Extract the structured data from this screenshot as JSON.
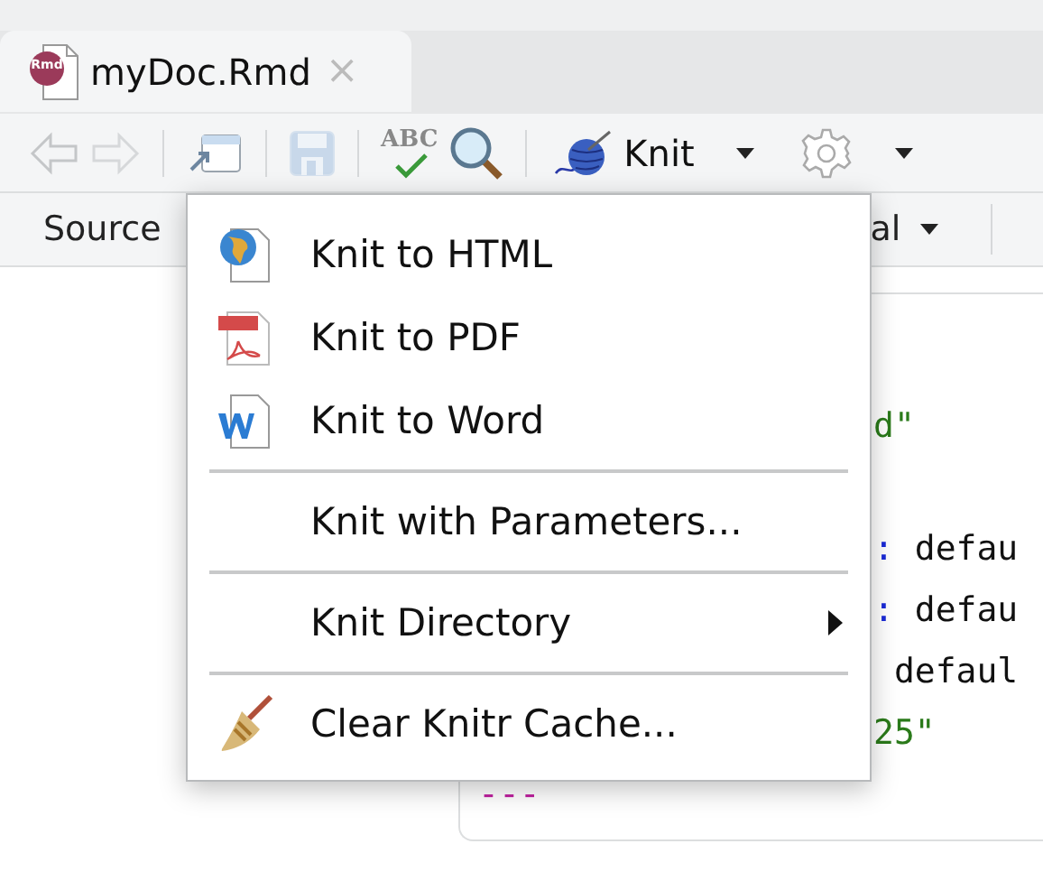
{
  "tab": {
    "icon_text": "Rmd",
    "title": "myDoc.Rmd",
    "close": "×",
    "selected": true
  },
  "toolbar": {
    "spell_label": "ABC",
    "knit_label": "Knit"
  },
  "source_bar": {
    "source_label": "Source",
    "partial_label": "al"
  },
  "code_lines": [
    {
      "kind": "yaml",
      "segments": [
        {
          "text": "d\"",
          "kind": "string"
        }
      ]
    },
    {
      "kind": "yaml",
      "segments": [
        {
          "text": ":",
          "kind": "punct"
        },
        {
          "text": " defau",
          "kind": "plain"
        }
      ]
    },
    {
      "kind": "yaml",
      "segments": [
        {
          "text": ":",
          "kind": "punct"
        },
        {
          "text": " defau",
          "kind": "plain"
        }
      ]
    },
    {
      "kind": "yaml",
      "segments": [
        {
          "text": " defaul",
          "kind": "plain"
        }
      ]
    },
    {
      "kind": "yaml",
      "segments": [
        {
          "text": "25\"",
          "kind": "string"
        }
      ]
    },
    {
      "kind": "fence",
      "segments": [
        {
          "text": "---",
          "kind": "fence"
        }
      ]
    }
  ],
  "knit_menu": [
    {
      "kind": "html",
      "label": "Knit to HTML"
    },
    {
      "kind": "pdf",
      "label": "Knit to PDF"
    },
    {
      "kind": "word",
      "label": "Knit to Word"
    },
    {
      "kind": "separator"
    },
    {
      "kind": "plain",
      "label": "Knit with Parameters..."
    },
    {
      "kind": "separator"
    },
    {
      "kind": "submenu",
      "label": "Knit Directory"
    },
    {
      "kind": "separator"
    },
    {
      "kind": "broom",
      "label": "Clear Knitr Cache..."
    }
  ]
}
